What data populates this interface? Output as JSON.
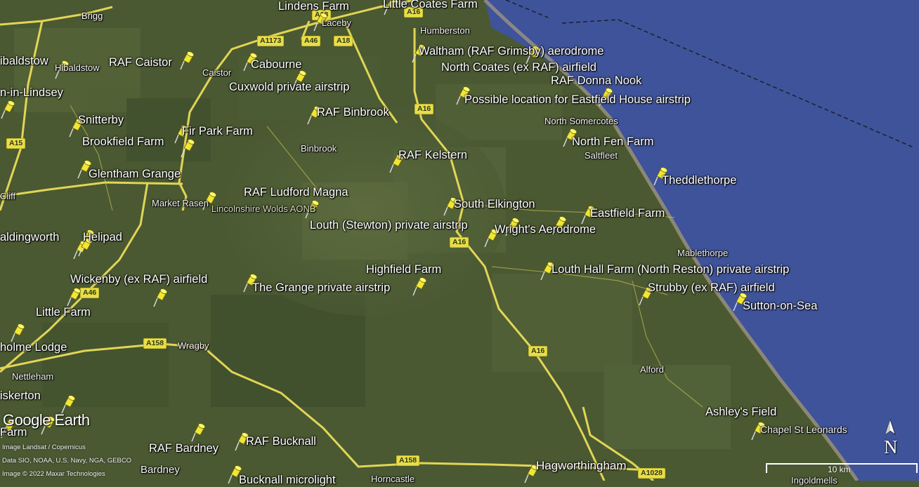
{
  "map": {
    "places": [
      {
        "text": "Brigg",
        "cls": "small"
      },
      {
        "text": "Lindens Farm",
        "cls": "big"
      },
      {
        "text": "Little Coates Farm",
        "cls": "big"
      },
      {
        "text": "Laceby",
        "cls": "small"
      },
      {
        "text": "Humberston",
        "cls": "small"
      },
      {
        "text": "ibaldstow",
        "cls": "big"
      },
      {
        "text": "Hibaldstow",
        "cls": "small"
      },
      {
        "text": "RAF Caistor",
        "cls": "big"
      },
      {
        "text": "Caistor",
        "cls": "small"
      },
      {
        "text": "Cabourne",
        "cls": "big"
      },
      {
        "text": "Waltham (RAF Grimsby) aerodrome",
        "cls": "big"
      },
      {
        "text": "North Coates (ex RAF) airfield",
        "cls": "big"
      },
      {
        "text": "RAF Donna Nook",
        "cls": "big"
      },
      {
        "text": "Cuxwold private airstrip",
        "cls": "big"
      },
      {
        "text": "n-in-Lindsey",
        "cls": "big"
      },
      {
        "text": "Possible location for Eastfield House airstrip",
        "cls": "big"
      },
      {
        "text": "RAF Binbrook",
        "cls": "big"
      },
      {
        "text": "Snitterby",
        "cls": "big"
      },
      {
        "text": "North Somercotes",
        "cls": "small"
      },
      {
        "text": "Fir Park Farm",
        "cls": "big"
      },
      {
        "text": "Brookfield Farm",
        "cls": "big"
      },
      {
        "text": "North Fen Farm",
        "cls": "big"
      },
      {
        "text": "Binbrook",
        "cls": "small"
      },
      {
        "text": "Saltfleet",
        "cls": "small"
      },
      {
        "text": "RAF Kelstern",
        "cls": "big"
      },
      {
        "text": "Glentham Grange",
        "cls": "big"
      },
      {
        "text": "Theddlethorpe",
        "cls": "big"
      },
      {
        "text": "RAF Ludford Magna",
        "cls": "big"
      },
      {
        "text": "Cliff",
        "cls": "small"
      },
      {
        "text": "Market Rasen",
        "cls": "small"
      },
      {
        "text": "South Elkington",
        "cls": "big"
      },
      {
        "text": "Lincolnshire Wolds AONB",
        "cls": "small"
      },
      {
        "text": "Eastfield Farm",
        "cls": "big"
      },
      {
        "text": "Louth (Stewton) private airstrip",
        "cls": "big"
      },
      {
        "text": "Wright's Aerodrome",
        "cls": "big"
      },
      {
        "text": "aldingworth",
        "cls": "big"
      },
      {
        "text": "Helipad",
        "cls": "big"
      },
      {
        "text": "Mablethorpe",
        "cls": "small"
      },
      {
        "text": "Highfield Farm",
        "cls": "big"
      },
      {
        "text": "Louth Hall Farm (North Reston) private airstrip",
        "cls": "big"
      },
      {
        "text": "Wickenby (ex RAF) airfield",
        "cls": "big"
      },
      {
        "text": "The Grange private airstrip",
        "cls": "big"
      },
      {
        "text": "Strubby (ex RAF) airfield",
        "cls": "big"
      },
      {
        "text": "Sutton-on-Sea",
        "cls": "big"
      },
      {
        "text": "Little Farm",
        "cls": "big"
      },
      {
        "text": "holme Lodge",
        "cls": "big"
      },
      {
        "text": "Wragby",
        "cls": "small"
      },
      {
        "text": "Alford",
        "cls": "small"
      },
      {
        "text": "Nettleham",
        "cls": "small"
      },
      {
        "text": "iskerton",
        "cls": "big"
      },
      {
        "text": "Ashley's Field",
        "cls": "big"
      },
      {
        "text": "Chapel St Leonards",
        "cls": "small"
      },
      {
        "text": "Farm",
        "cls": "big"
      },
      {
        "text": "RAF Bardney",
        "cls": "big"
      },
      {
        "text": "RAF Bucknall",
        "cls": "big"
      },
      {
        "text": "Bardney",
        "cls": "small"
      },
      {
        "text": "Hagworthingham",
        "cls": "big"
      },
      {
        "text": "Bucknall microlight",
        "cls": "big"
      },
      {
        "text": "Horncastle",
        "cls": "small"
      },
      {
        "text": "Ingoldmells",
        "cls": "small"
      }
    ],
    "roads": [
      "A18",
      "A16",
      "A1173",
      "A46",
      "A18",
      "A16",
      "A15",
      "A16",
      "A46",
      "A158",
      "A16",
      "A158",
      "A1028"
    ],
    "pin_count": 45,
    "colors": {
      "land": "#4b5a33",
      "sea": "#3f539a",
      "road": "#f2e35a",
      "pin": "#f1e733"
    }
  },
  "branding": {
    "logo": "Google Earth"
  },
  "attribution": [
    "Image Landsat / Copernicus",
    "Data SIO, NOAA, U.S. Navy, NGA, GEBCO",
    "Image © 2022 Maxar Technologies"
  ],
  "scale": {
    "label": "10 km"
  },
  "compass": {
    "label": "N"
  }
}
